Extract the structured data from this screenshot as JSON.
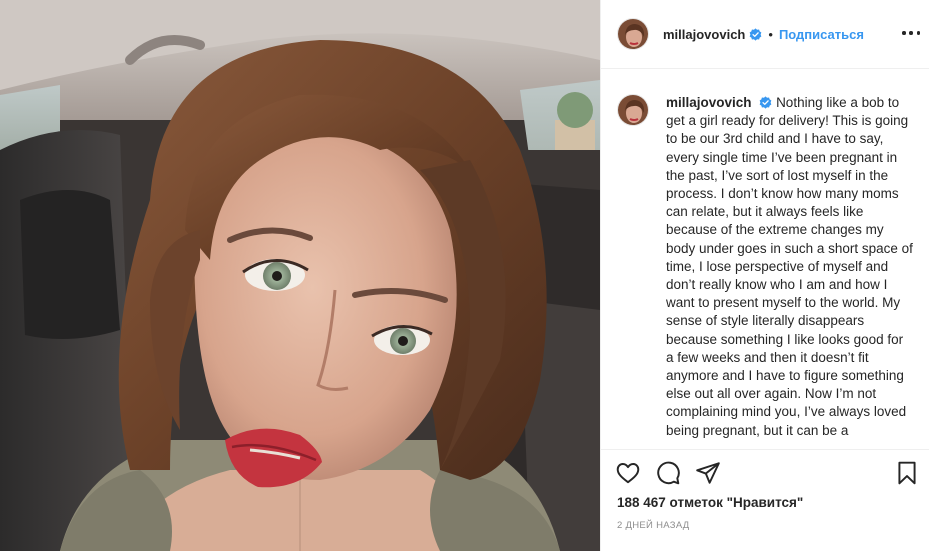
{
  "header": {
    "username": "millajovovich",
    "separator": "•",
    "follow_label": "Подписаться"
  },
  "caption": {
    "username": "millajovovich",
    "text": "Nothing like a bob to get a girl ready for delivery! This is going to be our 3rd child and I have to say, every single time I’ve been pregnant in the past, I’ve sort of lost myself in the process. I don’t know how many moms can relate, but it always feels like because of the extreme changes my body under goes in such a short space of time, I lose perspective of myself and don’t really know who I am and how I want to present myself to the world. My sense of style literally disappears because something I like looks good for a few weeks and then it doesn’t fit anymore and I have to figure something else out all over again. Now I’m not complaining mind you, I’ve always loved being pregnant, but it can be a"
  },
  "stats": {
    "likes": "188 467 отметок \"Нравится\"",
    "time_ago": "2 дней назад"
  },
  "icons": {
    "like": "heart-icon",
    "comment": "comment-icon",
    "share": "paper-plane-icon",
    "save": "bookmark-icon",
    "verified": "verified-badge-icon",
    "more": "more-options-icon"
  },
  "colors": {
    "accent": "#3897f0",
    "text": "#262626",
    "muted": "#8e8e8e",
    "border": "#efefef"
  }
}
